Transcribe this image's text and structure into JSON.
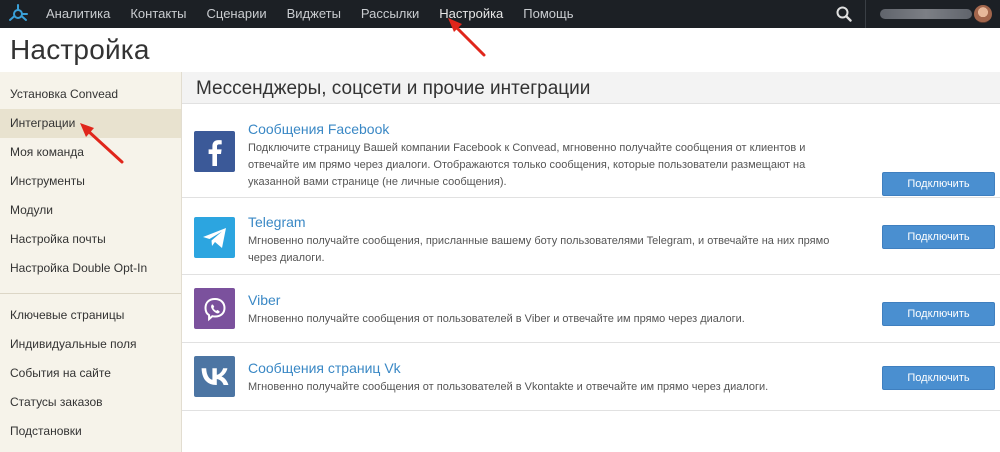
{
  "nav": {
    "items": [
      {
        "label": "Аналитика"
      },
      {
        "label": "Контакты"
      },
      {
        "label": "Сценарии"
      },
      {
        "label": "Виджеты"
      },
      {
        "label": "Рассылки"
      },
      {
        "label": "Настройка"
      },
      {
        "label": "Помощь"
      }
    ],
    "active_index": 5
  },
  "page": {
    "title": "Настройка"
  },
  "sidebar": {
    "group1": [
      {
        "label": "Установка Convead"
      },
      {
        "label": "Интеграции"
      },
      {
        "label": "Моя команда"
      },
      {
        "label": "Инструменты"
      },
      {
        "label": "Модули"
      },
      {
        "label": "Настройка почты"
      },
      {
        "label": "Настройка Double Opt-In"
      }
    ],
    "group2": [
      {
        "label": "Ключевые страницы"
      },
      {
        "label": "Индивидуальные поля"
      },
      {
        "label": "События на сайте"
      },
      {
        "label": "Статусы заказов"
      },
      {
        "label": "Подстановки"
      }
    ],
    "active": "Интеграции"
  },
  "main": {
    "section_title": "Мессенджеры, соцсети и прочие интеграции",
    "integrations": [
      {
        "title": "Сообщения Facebook",
        "description": "Подключите страницу Вашей компании Facebook к Convead, мгновенно получайте сообщения от клиентов и отвечайте им прямо через диалоги. Отображаются только сообщения, которые пользователи размещают на указанной вами странице (не личные сообщения).",
        "button": "Подключить",
        "icon": "facebook-icon",
        "color": "#3b5998"
      },
      {
        "title": "Telegram",
        "description": "Мгновенно получайте сообщения, присланные вашему боту пользователями Telegram, и отвечайте на них прямо через диалоги.",
        "button": "Подключить",
        "icon": "telegram-icon",
        "color": "#2ca5e0"
      },
      {
        "title": "Viber",
        "description": "Мгновенно получайте сообщения от пользователей в Viber и отвечайте им прямо через диалоги.",
        "button": "Подключить",
        "icon": "viber-icon",
        "color": "#7b519d"
      },
      {
        "title": "Сообщения страниц Vk",
        "description": "Мгновенно получайте сообщения от пользователей в Vkontakte и отвечайте им прямо через диалоги.",
        "button": "Подключить",
        "icon": "vk-icon",
        "color": "#4c75a3"
      }
    ]
  },
  "colors": {
    "topbar": "#1c2025",
    "link": "#3a88c5",
    "button": "#4a8fd0",
    "sidebar_bg": "#f6f3ea"
  }
}
